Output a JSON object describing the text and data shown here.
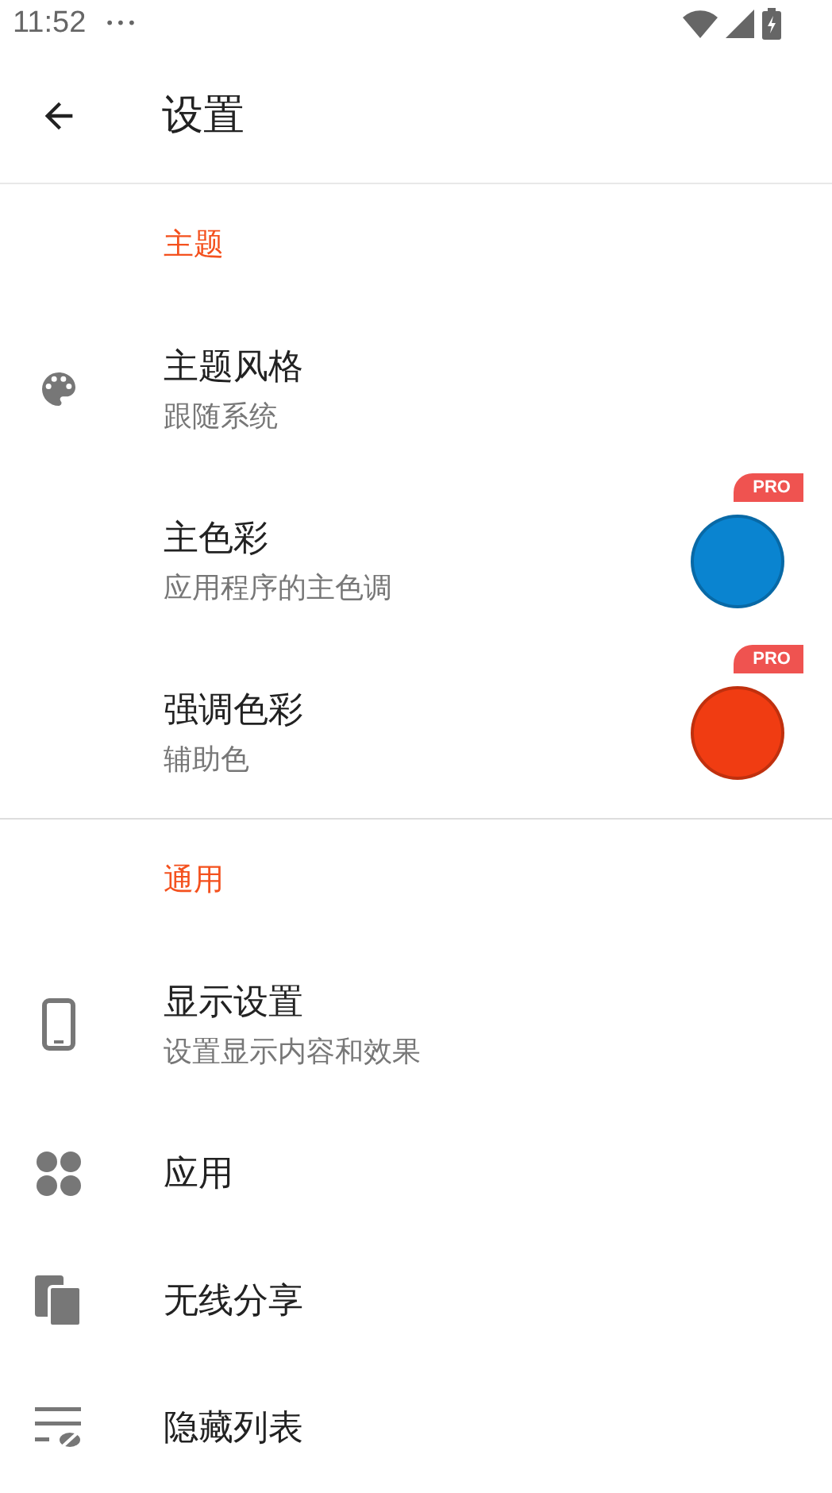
{
  "status_bar": {
    "time": "11:52",
    "more": "•••"
  },
  "app_bar": {
    "title": "设置"
  },
  "sections": [
    {
      "header": "主题",
      "items": [
        {
          "kind": "plain",
          "title": "主题风格",
          "subtitle": "跟随系统"
        },
        {
          "kind": "swatch",
          "title": "主色彩",
          "subtitle": "应用程序的主色调",
          "color": "#0a84d0",
          "badge": "PRO"
        },
        {
          "kind": "swatch",
          "title": "强调色彩",
          "subtitle": "辅助色",
          "color": "#f03c12",
          "badge": "PRO"
        }
      ]
    },
    {
      "header": "通用",
      "items": [
        {
          "kind": "plain",
          "title": "显示设置",
          "subtitle": "设置显示内容和效果"
        },
        {
          "kind": "plain",
          "title": "应用"
        },
        {
          "kind": "plain",
          "title": "无线分享"
        },
        {
          "kind": "plain",
          "title": "隐藏列表"
        }
      ]
    }
  ]
}
